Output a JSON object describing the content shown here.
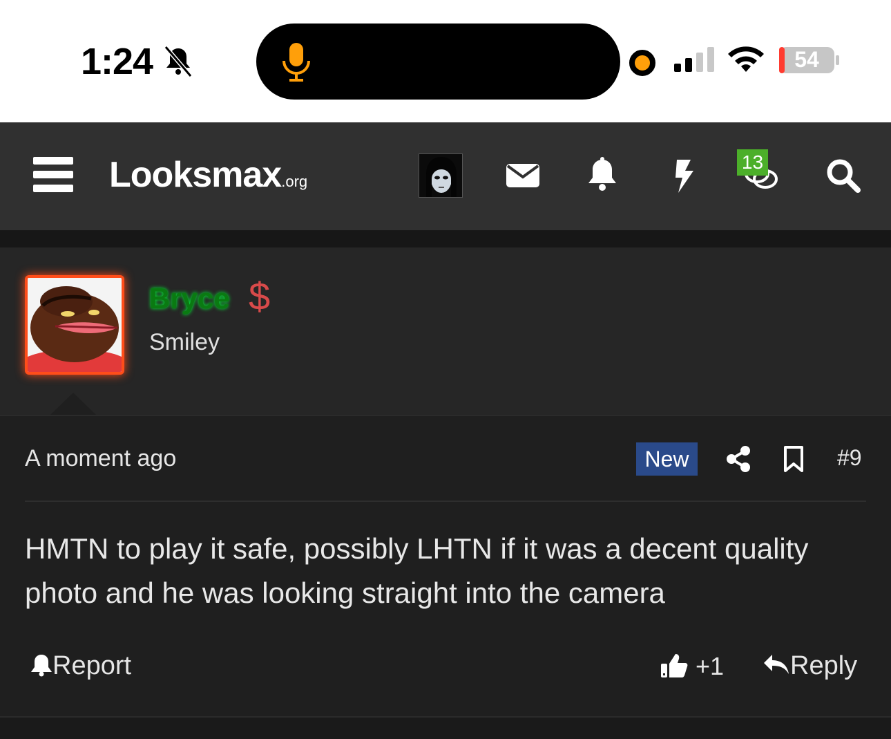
{
  "status_bar": {
    "time": "1:24",
    "battery": "54"
  },
  "header": {
    "logo_main": "Looksmax",
    "logo_suffix": ".org",
    "conversations_badge": "13"
  },
  "user": {
    "name": "Bryce",
    "title": "Smiley",
    "name_color": "#0a7a12"
  },
  "post": {
    "time": "A moment ago",
    "new_label": "New",
    "number": "#9",
    "body": "HMTN to play it safe, possibly LHTN if it was a decent quality photo and he was looking straight into the camera",
    "report_label": "Report",
    "like_count": "+1",
    "reply_label": "Reply"
  },
  "colors": {
    "avatar_border": "#ff4d1a",
    "badge": "#4caf2a",
    "new_badge": "#2a4a8a"
  }
}
